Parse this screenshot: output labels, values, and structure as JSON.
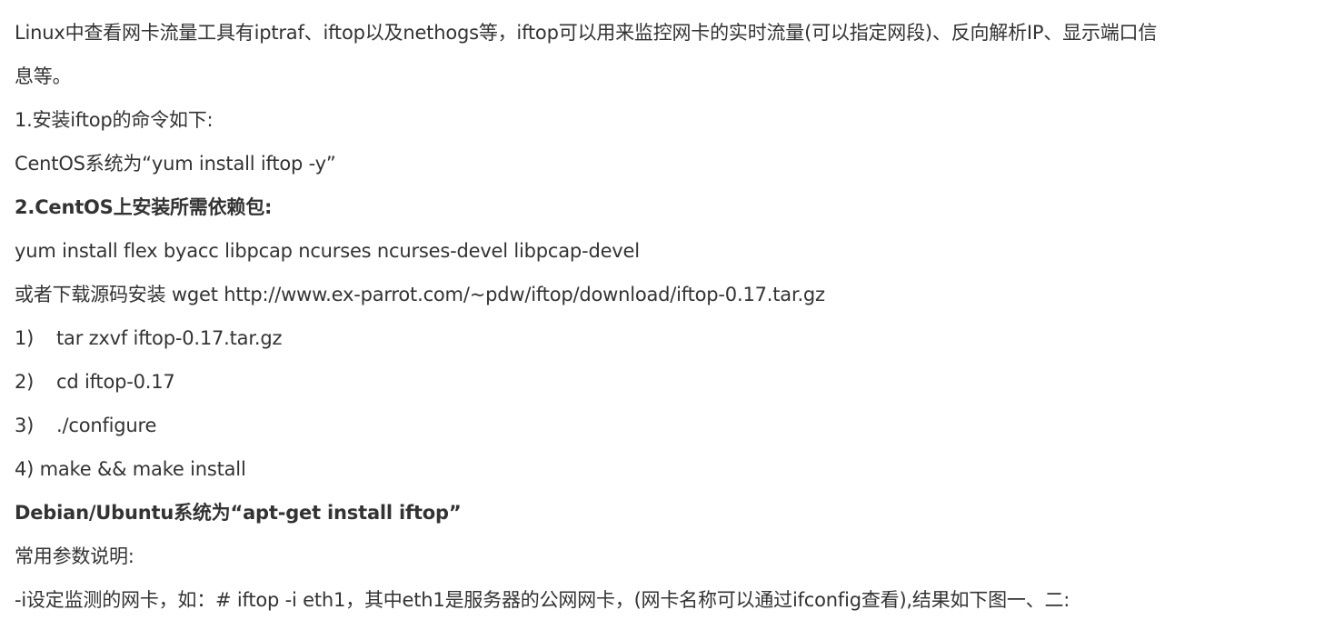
{
  "article": {
    "intro_line1": "Linux中查看网卡流量工具有iptraf、iftop以及nethogs等，iftop可以用来监控网卡的实时流量(可以指定网段)、反向解析IP、显示端口信",
    "intro_line2": "息等。",
    "install_heading": "1.安装iftop的命令如下:",
    "centos_cmd": "CentOS系统为“yum install iftop -y”",
    "deps_heading": "2.CentOS上安装所需依赖包:",
    "deps_cmd": "yum install flex byacc  libpcap ncurses ncurses-devel libpcap-devel",
    "source_download": "或者下载源码安装 wget http://www.ex-parrot.com/~pdw/iftop/download/iftop-0.17.tar.gz",
    "steps": [
      {
        "num": "1)",
        "cmd": "tar zxvf iftop-0.17.tar.gz"
      },
      {
        "num": "2)",
        "cmd": "cd iftop-0.17"
      },
      {
        "num": "3)",
        "cmd": "./configure"
      }
    ],
    "step4": "4) make && make install",
    "debian_cmd": "Debian/Ubuntu系统为“apt-get install iftop”",
    "params_heading": "常用参数说明:",
    "param_i": "-i设定监测的网卡，如：# iftop -i eth1，其中eth1是服务器的公网网卡，(网卡名称可以通过ifconfig查看),结果如下图一、二:"
  }
}
